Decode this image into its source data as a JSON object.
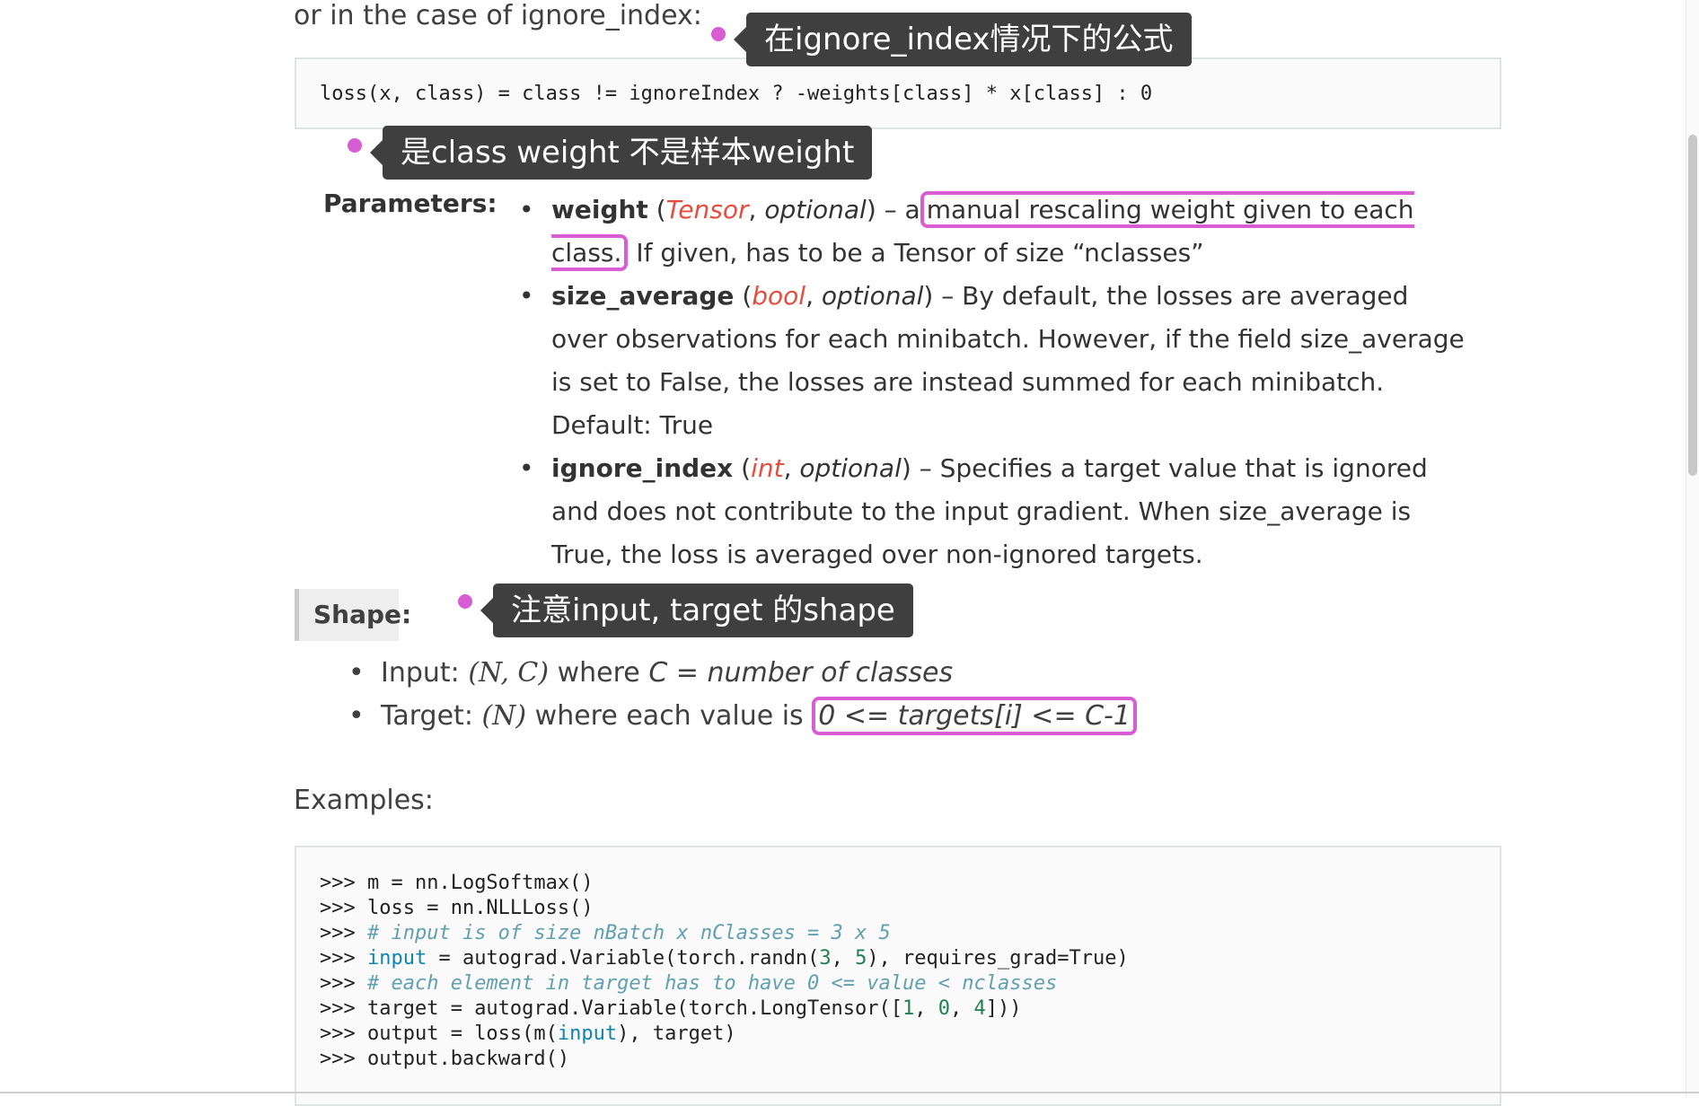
{
  "intro_text": "or in the case of ignore_index:",
  "formula": "loss(x, class) = class != ignoreIndex ? -weights[class] * x[class] : 0",
  "annotations": {
    "formula_note": "在ignore_index情况下的公式",
    "weight_note": "是class weight 不是样本weight",
    "shape_note": "注意input, target 的shape"
  },
  "parameters": {
    "label": "Parameters:",
    "items": [
      {
        "name": "weight",
        "type": "Tensor",
        "optional": "optional",
        "dash": "– a",
        "highlight": "manual rescaling weight given to each class.",
        "rest": " If given, has to be a Tensor of size “nclasses”"
      },
      {
        "name": "size_average",
        "type": "bool",
        "optional": "optional",
        "desc": "– By default, the losses are averaged over observations for each minibatch. However, if the field size_average is set to False, the losses are instead summed for each minibatch. Default: True"
      },
      {
        "name": "ignore_index",
        "type": "int",
        "optional": "optional",
        "desc": "– Specifies a target value that is ignored and does not contribute to the input gradient. When size_average is True, the loss is averaged over non-ignored targets."
      }
    ]
  },
  "shape": {
    "label": "Shape:",
    "input_prefix": "Input: ",
    "input_math": "(N, C)",
    "input_mid": " where ",
    "input_var": "C",
    "input_eq": " = ",
    "input_desc": "number of classes",
    "target_prefix": "Target: ",
    "target_math": "(N)",
    "target_mid": " where each value is ",
    "target_highlight": "0 <= targets[i] <= C-1"
  },
  "examples": {
    "label": "Examples:",
    "lines": [
      {
        "prompt": ">>> ",
        "code": "m = nn.LogSoftmax()"
      },
      {
        "prompt": ">>> ",
        "code": "loss = nn.NLLLoss()"
      },
      {
        "prompt": ">>> ",
        "comment": "# input is of size nBatch x nClasses = 3 x 5"
      },
      {
        "prompt": ">>> ",
        "kw": "input",
        "code": " = autograd.Variable(torch.randn(",
        "n1": "3",
        "sep": ", ",
        "n2": "5",
        "tail": "), requires_grad=True)"
      },
      {
        "prompt": ">>> ",
        "comment": "# each element in target has to have 0 <= value < nclasses"
      },
      {
        "prompt": ">>> ",
        "code": "target = autograd.Variable(torch.LongTensor([",
        "n1": "1",
        "sep": ", ",
        "n2": "0",
        "sep2": ", ",
        "n3": "4",
        "tail": "]))"
      },
      {
        "prompt": ">>> ",
        "code": "output = loss(m(",
        "kw": "input",
        "tail": "), target)"
      },
      {
        "prompt": ">>> ",
        "code": "output.backward()"
      }
    ]
  },
  "colors": {
    "highlight_border": "#d85dd5",
    "type_red": "#e74c3c",
    "tag_bg": "#3f3f3f"
  }
}
